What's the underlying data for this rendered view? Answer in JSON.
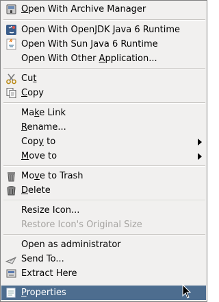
{
  "menu": {
    "items": [
      {
        "id": "open-with-archive-manager",
        "pre": "",
        "mn": "O",
        "post": "pen With Archive Manager",
        "icon": "archive-manager-icon"
      },
      {
        "id": "open-with-openjdk",
        "pre": "Open With OpenJDK Java 6 Runtime",
        "mn": "",
        "post": "",
        "icon": "java-openjdk-icon"
      },
      {
        "id": "open-with-sun-java",
        "pre": "Open With Sun Java 6 Runtime",
        "mn": "",
        "post": "",
        "icon": "java-sun-icon"
      },
      {
        "id": "open-with-other-application",
        "pre": "Open With Other ",
        "mn": "A",
        "post": "pplication...",
        "icon": ""
      },
      {
        "id": "cut",
        "pre": "Cu",
        "mn": "t",
        "post": "",
        "icon": "scissors-icon"
      },
      {
        "id": "copy",
        "pre": "",
        "mn": "C",
        "post": "opy",
        "icon": "copy-icon"
      },
      {
        "id": "make-link",
        "pre": "Ma",
        "mn": "k",
        "post": "e Link",
        "icon": ""
      },
      {
        "id": "rename",
        "pre": "",
        "mn": "R",
        "post": "ename...",
        "icon": ""
      },
      {
        "id": "copy-to",
        "pre": "Cop",
        "mn": "y",
        "post": " to",
        "icon": "",
        "submenu": true
      },
      {
        "id": "move-to",
        "pre": "",
        "mn": "M",
        "post": "ove to",
        "icon": "",
        "submenu": true
      },
      {
        "id": "move-to-trash",
        "pre": "Mo",
        "mn": "v",
        "post": "e to Trash",
        "icon": "trash-icon"
      },
      {
        "id": "delete",
        "pre": "",
        "mn": "D",
        "post": "elete",
        "icon": "delete-icon"
      },
      {
        "id": "resize-icon",
        "pre": "Resize Icon...",
        "mn": "",
        "post": "",
        "icon": ""
      },
      {
        "id": "restore-icon-size",
        "pre": "Restore Icon's Original Size",
        "mn": "",
        "post": "",
        "icon": "",
        "disabled": true
      },
      {
        "id": "open-as-administrator",
        "pre": "Open as administrator",
        "mn": "",
        "post": "",
        "icon": ""
      },
      {
        "id": "send-to",
        "pre": "Send To...",
        "mn": "",
        "post": "",
        "icon": "send-to-icon"
      },
      {
        "id": "extract-here",
        "pre": "Extract Here",
        "mn": "",
        "post": "",
        "icon": "extract-icon"
      },
      {
        "id": "properties",
        "pre": "",
        "mn": "P",
        "post": "roperties",
        "icon": "properties-icon",
        "selected": true
      }
    ]
  },
  "colors": {
    "menu_bg": "#f1f0ef",
    "selected_bg": "#4d6d8f",
    "disabled_text": "#a5a3a0"
  }
}
